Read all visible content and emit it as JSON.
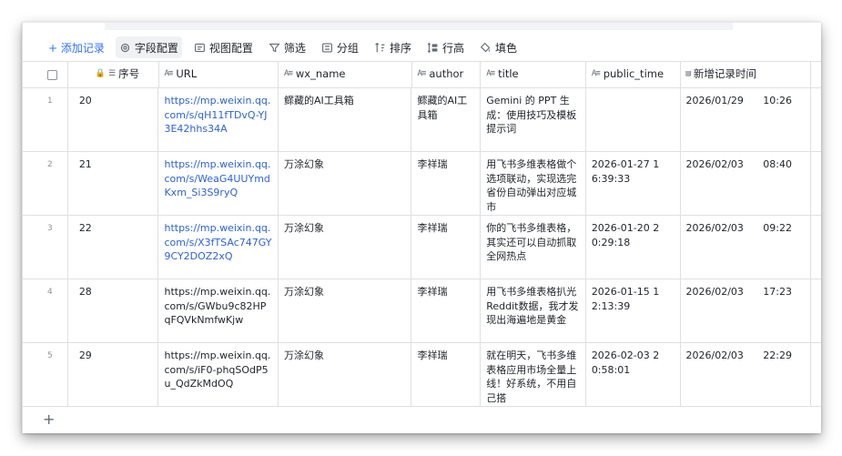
{
  "toolbar": {
    "add_record": "+ 添加记录",
    "field_config": "字段配置",
    "view_config": "视图配置",
    "filter": "筛选",
    "group": "分组",
    "sort": "排序",
    "row_height": "行高",
    "fill_color": "填色"
  },
  "columns": {
    "seq": "序号",
    "url": "URL",
    "wx_name": "wx_name",
    "author": "author",
    "title": "title",
    "public_time": "public_time",
    "new_time": "新增记录时间"
  },
  "rows": [
    {
      "num": "1",
      "seq": "20",
      "url": "https://mp.weixin.qq.com/s/qH11fTDvQ-YJ3E42hhs34A",
      "url_linked": true,
      "wx_name": "鳏藏的AI工具箱",
      "author": "鳏藏的AI工具箱",
      "title": "Gemini 的 PPT 生成：使用技巧及模板提示词",
      "public_time": "",
      "new_date": "2026/01/29",
      "new_clock": "10:26"
    },
    {
      "num": "2",
      "seq": "21",
      "url": "https://mp.weixin.qq.com/s/WeaG4UUYmdKxm_Si3S9ryQ",
      "url_linked": true,
      "wx_name": "万涂幻象",
      "author": "李祥瑞",
      "title": "用飞书多维表格做个选项联动，实现选完省份自动弹出对应城市",
      "public_time": "2026-01-27 16:39:33",
      "new_date": "2026/02/03",
      "new_clock": "08:40"
    },
    {
      "num": "3",
      "seq": "22",
      "url": "https://mp.weixin.qq.com/s/X3fTSAc747GY9CY2DOZ2xQ",
      "url_linked": true,
      "wx_name": "万涂幻象",
      "author": "李祥瑞",
      "title": "你的飞书多维表格，其实还可以自动抓取全网热点",
      "public_time": "2026-01-20 20:29:18",
      "new_date": "2026/02/03",
      "new_clock": "09:22"
    },
    {
      "num": "4",
      "seq": "28",
      "url": "https://mp.weixin.qq.com/s/GWbu9c82HPqFQVkNmfwKjw",
      "url_linked": false,
      "wx_name": "万涂幻象",
      "author": "李祥瑞",
      "title": "用飞书多维表格扒光Reddit数据，我才发现出海遍地是黄金",
      "public_time": "2026-01-15 12:13:39",
      "new_date": "2026/02/03",
      "new_clock": "17:23"
    },
    {
      "num": "5",
      "seq": "29",
      "url": "https://mp.weixin.qq.com/s/iF0-phqSOdP5u_QdZkMdOQ",
      "url_linked": false,
      "wx_name": "万涂幻象",
      "author": "李祥瑞",
      "title": "就在明天，飞书多维表格应用市场全量上线！好系统，不用自己搭",
      "public_time": "2026-02-03 20:58:01",
      "new_date": "2026/02/03",
      "new_clock": "22:29"
    }
  ],
  "add_row_label": "+",
  "colors": {
    "accent": "#3370ff",
    "link": "#2b62d9",
    "border": "#dee0e3"
  }
}
